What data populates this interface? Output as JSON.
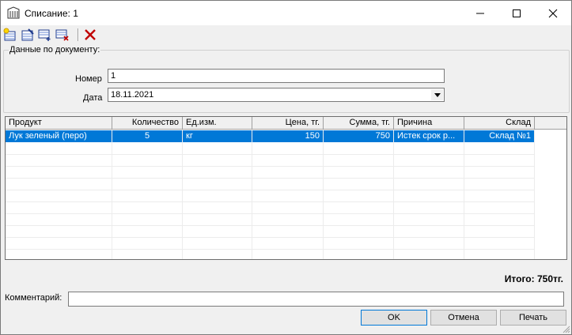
{
  "window": {
    "title": "Списание: 1",
    "icon": "building-icon"
  },
  "toolbar": {
    "buttons": [
      "new-document-icon",
      "edit-document-icon",
      "add-row-icon",
      "delete-row-icon",
      "delete-icon"
    ]
  },
  "doc_group": {
    "legend": "Данные по документу:",
    "number_label": "Номер",
    "number_value": "1",
    "date_label": "Дата",
    "date_value": "18.11.2021"
  },
  "grid": {
    "columns": [
      "Продукт",
      "Количество",
      "Ед.изм.",
      "Цена, тг.",
      "Сумма, тг.",
      "Причина",
      "Склад"
    ],
    "rows": [
      [
        "Лук зеленый (перо)",
        "5",
        "кг",
        "150",
        "750",
        "Истек срок р...",
        "Склад №1"
      ]
    ]
  },
  "total": "Итого: 750тг.",
  "comment": {
    "label": "Комментарий:",
    "value": ""
  },
  "buttons": {
    "ok": "OK",
    "cancel": "Отмена",
    "print": "Печать"
  },
  "colors": {
    "selection": "#0078d7",
    "delete": "#c00000"
  }
}
